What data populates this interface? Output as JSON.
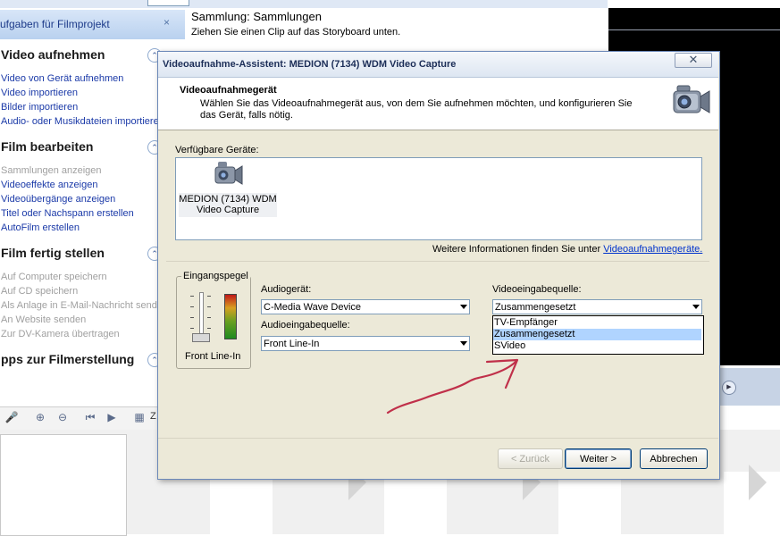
{
  "background": {
    "task_pane": {
      "header": "ufgaben für Filmprojekt",
      "close_glyph": "×",
      "sections": [
        {
          "title": "Video aufnehmen",
          "btn": "⌃",
          "items": [
            {
              "label": "Video von Gerät aufnehmen",
              "enabled": true
            },
            {
              "label": "Video importieren",
              "enabled": true
            },
            {
              "label": "Bilder importieren",
              "enabled": true
            },
            {
              "label": "Audio- oder Musikdateien importieren",
              "enabled": true
            }
          ]
        },
        {
          "title": "Film bearbeiten",
          "btn": "⌃",
          "items": [
            {
              "label": "Sammlungen anzeigen",
              "enabled": false
            },
            {
              "label": "Videoeffekte anzeigen",
              "enabled": true
            },
            {
              "label": "Videoübergänge anzeigen",
              "enabled": true
            },
            {
              "label": "Titel oder Nachspann erstellen",
              "enabled": true
            },
            {
              "label": "AutoFilm erstellen",
              "enabled": true
            }
          ]
        },
        {
          "title": "Film fertig stellen",
          "btn": "⌃",
          "items": [
            {
              "label": "Auf Computer speichern",
              "enabled": false
            },
            {
              "label": "Auf CD speichern",
              "enabled": false
            },
            {
              "label": "Als Anlage in E-Mail-Nachricht senden",
              "enabled": false
            },
            {
              "label": "An Website senden",
              "enabled": false
            },
            {
              "label": "Zur DV-Kamera übertragen",
              "enabled": false
            }
          ]
        },
        {
          "title": "pps zur Filmerstellung",
          "btn": "⌃",
          "items": []
        }
      ]
    },
    "collection": {
      "title": "Sammlung: Sammlungen",
      "subtitle": "Ziehen Sie einen Clip auf das Storyboard unten."
    },
    "toolbar_text": "Z"
  },
  "dialog": {
    "title": "Videoaufnahme-Assistent: MEDION (7134) WDM Video Capture",
    "close_glyph": "✕",
    "banner_heading": "Videoaufnahmegerät",
    "banner_description": "Wählen Sie das Videoaufnahmegerät aus, von dem Sie aufnehmen möchten, und konfigurieren Sie das Gerät, falls nötig.",
    "available_devices_label": "Verfügbare Geräte:",
    "device": {
      "line1": "MEDION (7134) WDM",
      "line2": "Video Capture"
    },
    "info_text": "Weitere Informationen finden Sie unter ",
    "info_link": "Videoaufnahmegeräte.",
    "input_level": {
      "caption": "Eingangspegel",
      "source_name": "Front Line-In",
      "level": 0.0
    },
    "audio_device": {
      "label": "Audiogerät:",
      "value": "C-Media Wave Device"
    },
    "audio_input": {
      "label": "Audioeingabequelle:",
      "value": "Front Line-In"
    },
    "video_input": {
      "label": "Videoeingabequelle:",
      "value": "Zusammengesetzt",
      "options": [
        "TV-Empfänger",
        "Zusammengesetzt",
        "SVideo"
      ],
      "selected_index": 1
    },
    "buttons": {
      "back": "< Zurück",
      "next": "Weiter >",
      "cancel": "Abbrechen"
    },
    "annotation_color": "#c0304a"
  }
}
